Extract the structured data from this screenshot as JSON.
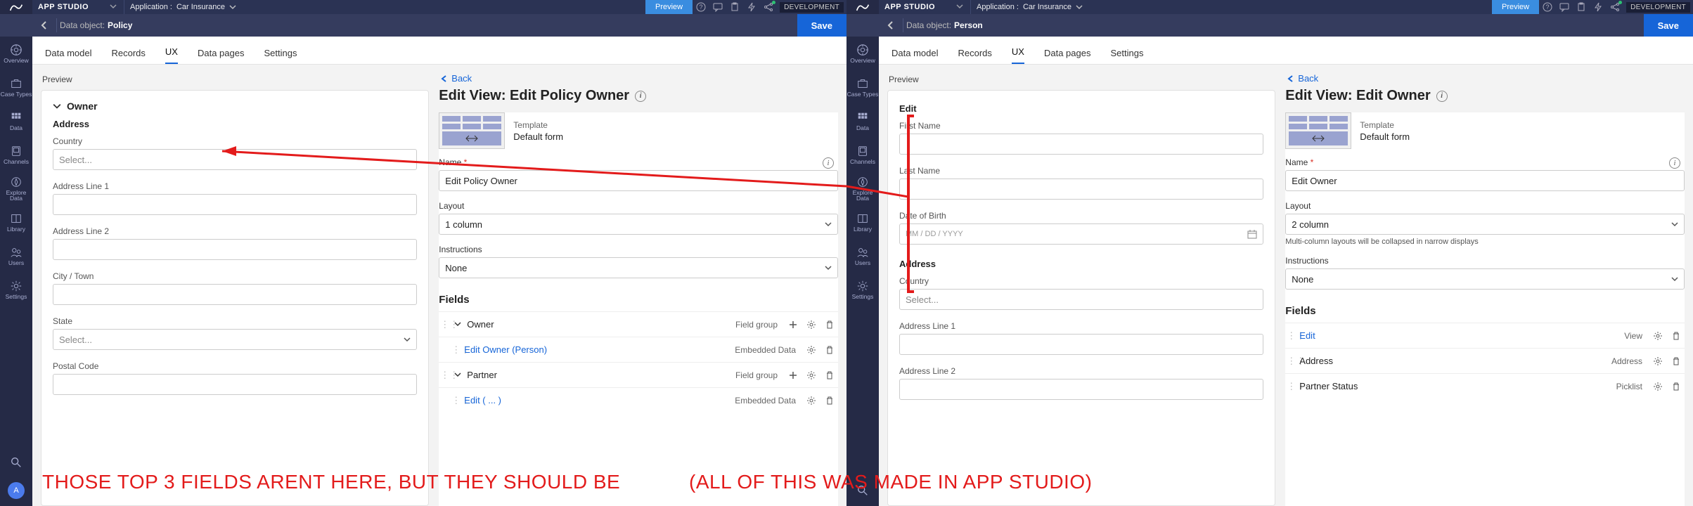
{
  "common": {
    "brand": "APP STUDIO",
    "app_prefix": "Application :",
    "app_name": "Car Insurance",
    "preview_btn": "Preview",
    "dev_badge": "DEVELOPMENT",
    "save": "Save",
    "data_object_prefix": "Data object:",
    "tabs": {
      "data_model": "Data model",
      "records": "Records",
      "ux": "UX",
      "data_pages": "Data pages",
      "settings": "Settings"
    },
    "leftnav": {
      "overview": "Overview",
      "case_types": "Case Types",
      "data": "Data",
      "channels": "Channels",
      "explore": "Explore Data",
      "library": "Library",
      "users": "Users",
      "settings": "Settings"
    },
    "avatar": "A",
    "preview_label": "Preview",
    "back": "Back",
    "template_label": "Template",
    "template_value": "Default form",
    "name_label": "Name",
    "layout_label": "Layout",
    "instructions_label": "Instructions",
    "instructions_value": "None",
    "fields_label": "Fields"
  },
  "left": {
    "data_object": "Policy",
    "preview": {
      "section1": "Owner",
      "section2": "Address",
      "country_label": "Country",
      "select_placeholder": "Select...",
      "addr1": "Address Line 1",
      "addr2": "Address Line 2",
      "city": "City / Town",
      "state": "State",
      "postal": "Postal Code"
    },
    "config": {
      "title": "Edit View: Edit Policy Owner",
      "name_value": "Edit Policy Owner",
      "layout_value": "1 column",
      "fields": {
        "owner": {
          "label": "Owner",
          "type": "Field group"
        },
        "edit_owner": {
          "label": "Edit Owner (Person)",
          "type": "Embedded Data"
        },
        "partner": {
          "label": "Partner",
          "type": "Field group"
        },
        "edit_partner": {
          "label": "Edit ( ... )",
          "type": "Embedded Data"
        }
      }
    }
  },
  "right": {
    "data_object": "Person",
    "preview": {
      "section1": "Edit",
      "first_name": "First Name",
      "last_name": "Last Name",
      "dob": "Date of Birth",
      "date_placeholder_mm": "MM",
      "date_sep": "/",
      "date_placeholder_dd": "DD",
      "date_placeholder_yyyy": "YYYY",
      "section2": "Address",
      "country_label": "Country",
      "select_placeholder": "Select...",
      "addr1": "Address Line 1",
      "addr2": "Address Line 2"
    },
    "config": {
      "title": "Edit View: Edit Owner",
      "name_value": "Edit Owner",
      "layout_value": "2 column",
      "layout_note": "Multi-column layouts will be collapsed in narrow displays",
      "fields": {
        "edit": {
          "label": "Edit",
          "type": "View"
        },
        "address": {
          "label": "Address",
          "type": "Address"
        },
        "partner_status": {
          "label": "Partner Status",
          "type": "Picklist"
        }
      }
    }
  },
  "annotation": {
    "left_text": "THOSE TOP 3 FIELDS ARENT HERE, BUT THEY SHOULD BE",
    "right_text": "(ALL OF THIS WAS MADE IN APP STUDIO)"
  }
}
